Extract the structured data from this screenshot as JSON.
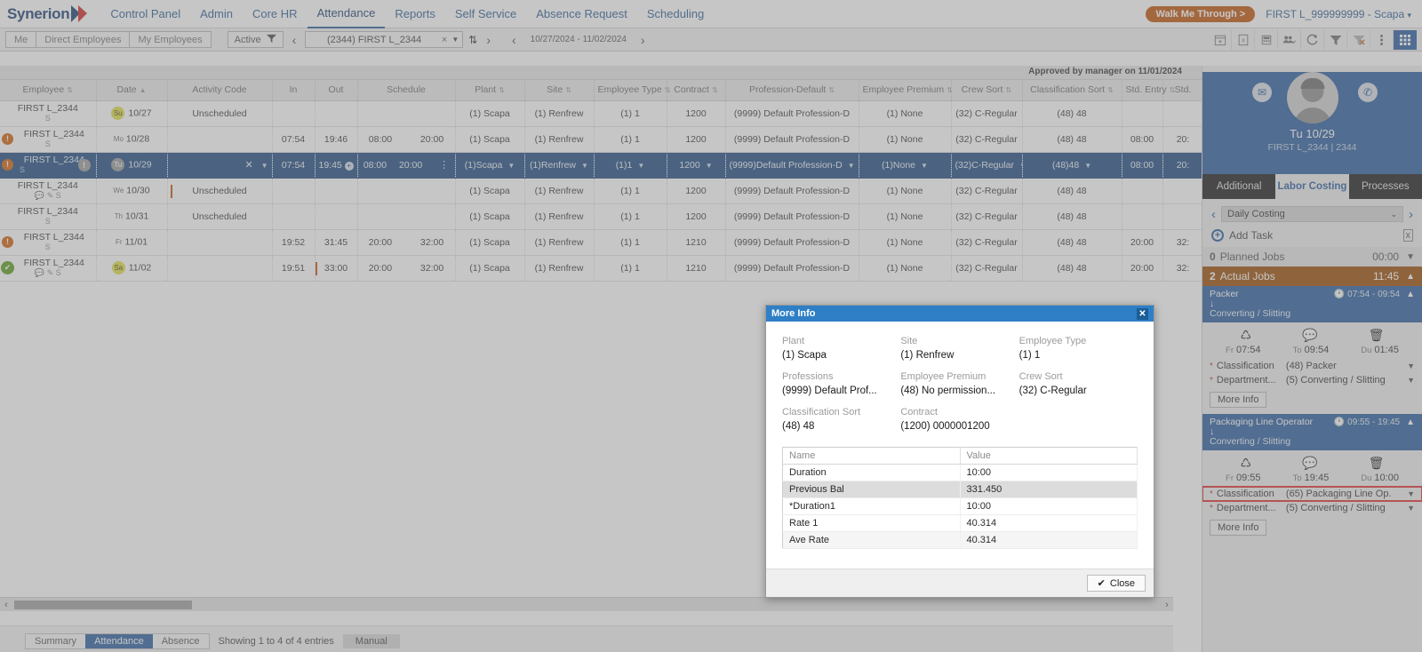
{
  "app": {
    "brand": "Synerion",
    "nav": [
      {
        "label": "Control Panel",
        "active": false
      },
      {
        "label": "Admin",
        "active": false
      },
      {
        "label": "Core HR",
        "active": false
      },
      {
        "label": "Attendance",
        "active": true
      },
      {
        "label": "Reports",
        "active": false
      },
      {
        "label": "Self Service",
        "active": false
      },
      {
        "label": "Absence Request",
        "active": false
      },
      {
        "label": "Scheduling",
        "active": false
      }
    ],
    "walk_me_through": "Walk Me Through >",
    "user_label": "FIRST L_999999999 - Scapa"
  },
  "toolbar": {
    "scope_buttons": [
      "Me",
      "Direct Employees",
      "My Employees"
    ],
    "status_filter": "Active",
    "employee_select": "(2344) FIRST L_2344",
    "date_range": "10/27/2024 - 11/02/2024",
    "icons": [
      "calendar-add-icon",
      "excel-export-icon",
      "calculator-icon",
      "people-icon",
      "refresh-icon",
      "filter-icon",
      "clear-filter-icon",
      "more-vertical-icon",
      "grid-view-icon"
    ]
  },
  "grid": {
    "approved_note": "Approved by manager on 11/01/2024",
    "columns": [
      {
        "label": "Employee",
        "sort": "both"
      },
      {
        "label": "Date",
        "sort": "asc"
      },
      {
        "label": "Activity Code",
        "sort": "none"
      },
      {
        "label": "In",
        "sort": "none"
      },
      {
        "label": "Out",
        "sort": "none"
      },
      {
        "label": "Schedule",
        "sort": "none"
      },
      {
        "label": "Plant",
        "sort": "both"
      },
      {
        "label": "Site",
        "sort": "both"
      },
      {
        "label": "Employee Type",
        "sort": "both"
      },
      {
        "label": "Contract",
        "sort": "both"
      },
      {
        "label": "Profession-Default",
        "sort": "both"
      },
      {
        "label": "Employee Premium",
        "sort": "both"
      },
      {
        "label": "Crew Sort",
        "sort": "both"
      },
      {
        "label": "Classification Sort",
        "sort": "both"
      },
      {
        "label": "Std. Entry",
        "sort": "both"
      },
      {
        "label": "Std.",
        "sort": "none"
      }
    ],
    "rows": [
      {
        "employee": "FIRST L_2344",
        "employee_sub": "S",
        "status": "none",
        "day": "Su",
        "day_style": "yellow",
        "date": "10/27",
        "activity": "Unscheduled",
        "in": "",
        "out": "",
        "sched_in": "",
        "sched_out": "",
        "plant": "(1) Scapa",
        "site": "(1) Renfrew",
        "emp_type": "(1) 1",
        "contract": "1200",
        "profession": "(9999) Default Profession-D",
        "premium": "(1) None",
        "crew": "(32) C-Regular",
        "classification": "(48) 48",
        "std_entry": "",
        "std": "",
        "selected": false
      },
      {
        "employee": "FIRST L_2344",
        "employee_sub": "S",
        "status": "alert",
        "day": "Mo",
        "day_style": "plain",
        "date": "10/28",
        "activity": "",
        "in": "07:54",
        "out": "19:46",
        "sched_in": "08:00",
        "sched_out": "20:00",
        "plant": "(1) Scapa",
        "site": "(1) Renfrew",
        "emp_type": "(1) 1",
        "contract": "1200",
        "profession": "(9999) Default Profession-D",
        "premium": "(1) None",
        "crew": "(32) C-Regular",
        "classification": "(48) 48",
        "std_entry": "08:00",
        "std": "20:",
        "selected": false
      },
      {
        "employee": "FIRST L_2344",
        "employee_sub": "S",
        "status": "alert",
        "day": "Tu",
        "day_style": "grey",
        "date": "10/29",
        "activity": "",
        "in": "07:54",
        "out": "19:45",
        "sched_in": "08:00",
        "sched_out": "20:00",
        "plant": "(1)Scapa",
        "site": "(1)Renfrew",
        "emp_type": "(1)1",
        "contract": "1200",
        "profession": "(9999)Default Profession-D",
        "premium": "(1)None",
        "crew": "(32)C-Regular",
        "classification": "(48)48",
        "std_entry": "08:00",
        "std": "20:",
        "selected": true
      },
      {
        "employee": "FIRST L_2344",
        "employee_sub": "S",
        "status": "none",
        "day": "We",
        "day_style": "plain",
        "date": "10/30",
        "activity": "Unscheduled",
        "in": "",
        "out": "",
        "sched_in": "",
        "sched_out": "",
        "plant": "(1) Scapa",
        "site": "(1) Renfrew",
        "emp_type": "(1) 1",
        "contract": "1200",
        "profession": "(9999) Default Profession-D",
        "premium": "(1) None",
        "crew": "(32) C-Regular",
        "classification": "(48) 48",
        "std_entry": "",
        "std": "",
        "selected": false
      },
      {
        "employee": "FIRST L_2344",
        "employee_sub": "S",
        "status": "none",
        "day": "Th",
        "day_style": "plain",
        "date": "10/31",
        "activity": "Unscheduled",
        "in": "",
        "out": "",
        "sched_in": "",
        "sched_out": "",
        "plant": "(1) Scapa",
        "site": "(1) Renfrew",
        "emp_type": "(1) 1",
        "contract": "1200",
        "profession": "(9999) Default Profession-D",
        "premium": "(1) None",
        "crew": "(32) C-Regular",
        "classification": "(48) 48",
        "std_entry": "",
        "std": "",
        "selected": false
      },
      {
        "employee": "FIRST L_2344",
        "employee_sub": "S",
        "status": "alert",
        "day": "Fr",
        "day_style": "plain",
        "date": "11/01",
        "activity": "",
        "in": "19:52",
        "out": "31:45",
        "sched_in": "20:00",
        "sched_out": "32:00",
        "plant": "(1) Scapa",
        "site": "(1) Renfrew",
        "emp_type": "(1) 1",
        "contract": "1210",
        "profession": "(9999) Default Profession-D",
        "premium": "(1) None",
        "crew": "(32) C-Regular",
        "classification": "(48) 48",
        "std_entry": "20:00",
        "std": "32:",
        "selected": false
      },
      {
        "employee": "FIRST L_2344",
        "employee_sub": "S",
        "status": "approved",
        "day": "Sa",
        "day_style": "yellow",
        "date": "11/02",
        "activity": "",
        "in": "19:51",
        "out": "33:00",
        "sched_in": "20:00",
        "sched_out": "32:00",
        "plant": "(1) Scapa",
        "site": "(1) Renfrew",
        "emp_type": "(1) 1",
        "contract": "1210",
        "profession": "(9999) Default Profession-D",
        "premium": "(1) None",
        "crew": "(32) C-Regular",
        "classification": "(48) 48",
        "std_entry": "20:00",
        "std": "32:",
        "selected": false
      }
    ]
  },
  "right_panel": {
    "date": "Tu 10/29",
    "employee": "FIRST L_2344 | 2344",
    "tabs": [
      {
        "label": "Additional",
        "active": false
      },
      {
        "label": "Labor Costing",
        "active": true
      },
      {
        "label": "Processes",
        "active": false
      }
    ],
    "view_select": "Daily Costing",
    "add_task": "Add Task",
    "planned_jobs": {
      "count": "0",
      "label": "Planned Jobs",
      "total": "00:00"
    },
    "actual_jobs": {
      "count": "2",
      "label": "Actual Jobs",
      "total": "11:45"
    },
    "tasks": [
      {
        "title": "Packer",
        "department": "Converting / Slitting",
        "time_range": "07:54 - 09:54",
        "from_label": "Fr",
        "from": "07:54",
        "to_label": "To",
        "to": "09:54",
        "dur_label": "Du",
        "dur": "01:45",
        "classification_label": "Classification",
        "classification": "(48) Packer",
        "department_label": "Department...",
        "department_value": "(5) Converting / Slitting",
        "more_info": "More Info",
        "highlight": false
      },
      {
        "title": "Packaging Line Operator",
        "department": "Converting / Slitting",
        "time_range": "09:55 - 19:45",
        "from_label": "Fr",
        "from": "09:55",
        "to_label": "To",
        "to": "19:45",
        "dur_label": "Du",
        "dur": "10:00",
        "classification_label": "Classification",
        "classification": "(65) Packaging Line Op.",
        "department_label": "Department...",
        "department_value": "(5) Converting / Slitting",
        "more_info": "More Info",
        "highlight": true
      }
    ]
  },
  "modal": {
    "title": "More Info",
    "fields": [
      {
        "key": "Plant",
        "value": "(1) Scapa"
      },
      {
        "key": "Site",
        "value": "(1) Renfrew"
      },
      {
        "key": "Employee Type",
        "value": "(1) 1"
      },
      {
        "key": "Professions",
        "value": "(9999) Default Prof..."
      },
      {
        "key": "Employee Premium",
        "value": "(48) No permission..."
      },
      {
        "key": "Crew Sort",
        "value": "(32) C-Regular"
      },
      {
        "key": "Classification Sort",
        "value": "(48) 48"
      },
      {
        "key": "Contract",
        "value": "(1200) 0000001200"
      },
      {
        "key": "",
        "value": ""
      }
    ],
    "table_headers": [
      "Name",
      "Value"
    ],
    "table_rows": [
      {
        "name": "Duration",
        "value": "10:00"
      },
      {
        "name": "Previous Bal",
        "value": "331.450"
      },
      {
        "name": "*Duration1",
        "value": "10:00"
      },
      {
        "name": "Rate 1",
        "value": "40.314"
      },
      {
        "name": "Ave Rate",
        "value": "40.314"
      }
    ],
    "close_label": "Close"
  },
  "bottom_bar": {
    "segments": [
      "Summary",
      "Attendance",
      "Absence"
    ],
    "note": "Showing 1 to 4 of 4 entries",
    "chip": "Manual"
  }
}
